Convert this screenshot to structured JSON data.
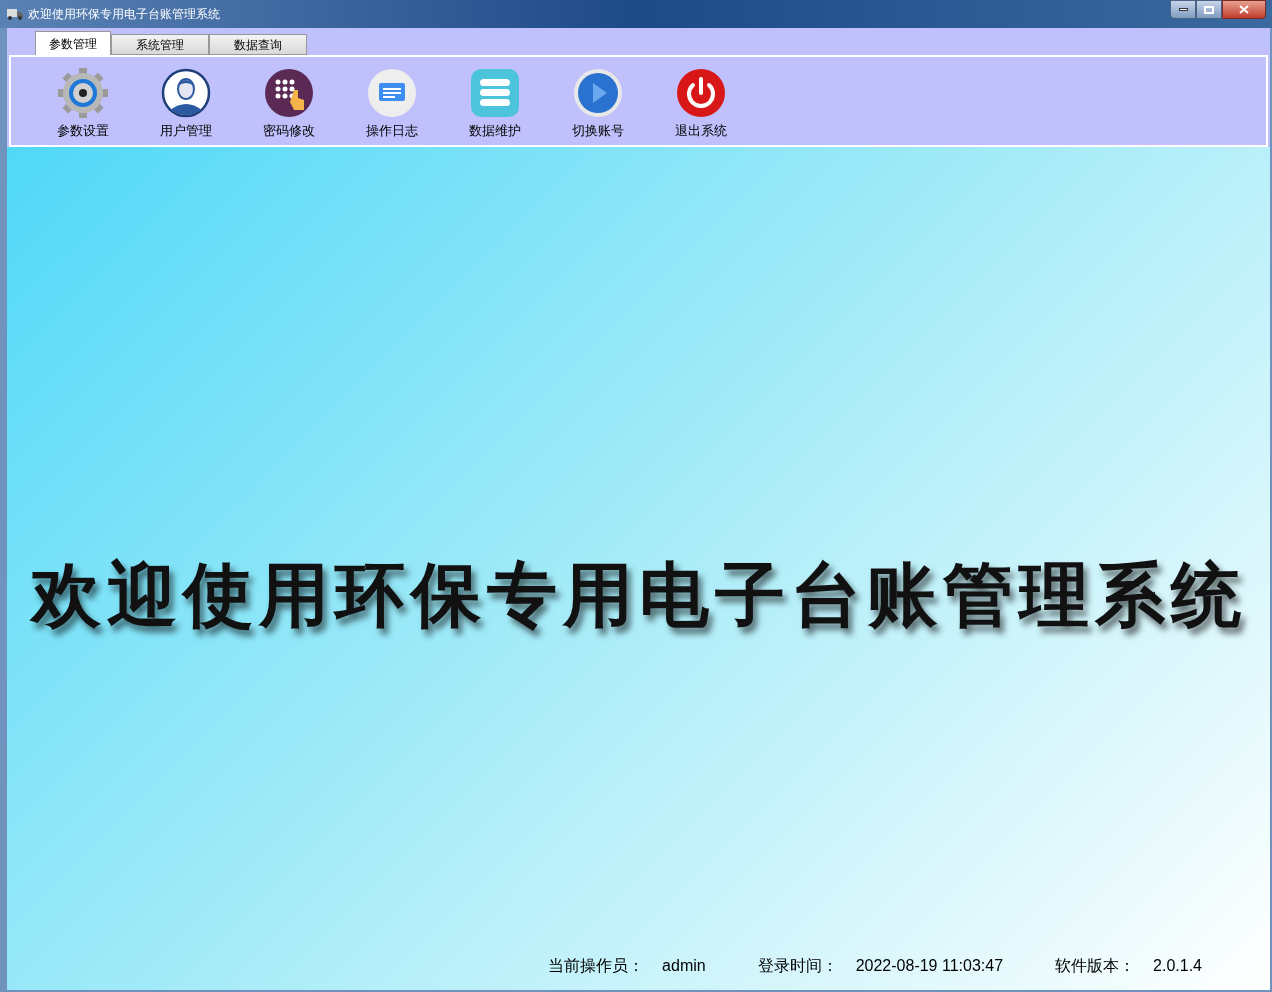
{
  "window": {
    "title": "欢迎使用环保专用电子台账管理系统"
  },
  "tabs": [
    {
      "label": "参数管理",
      "selected": true
    },
    {
      "label": "系统管理",
      "selected": false
    },
    {
      "label": "数据查询",
      "selected": false
    }
  ],
  "toolbar": [
    {
      "kind": "gear",
      "label": "参数设置"
    },
    {
      "kind": "user",
      "label": "用户管理"
    },
    {
      "kind": "keypad",
      "label": "密码修改"
    },
    {
      "kind": "note",
      "label": "操作日志"
    },
    {
      "kind": "database",
      "label": "数据维护"
    },
    {
      "kind": "play",
      "label": "切换账号"
    },
    {
      "kind": "power",
      "label": "退出系统"
    }
  ],
  "welcome": "欢迎使用环保专用电子台账管理系统",
  "status_bar": [
    {
      "label": "当前操作员：",
      "value": "admin"
    },
    {
      "label": "登录时间：",
      "value": "2022-08-19 11:03:47"
    },
    {
      "label": "软件版本：",
      "value": "2.0.1.4"
    }
  ]
}
